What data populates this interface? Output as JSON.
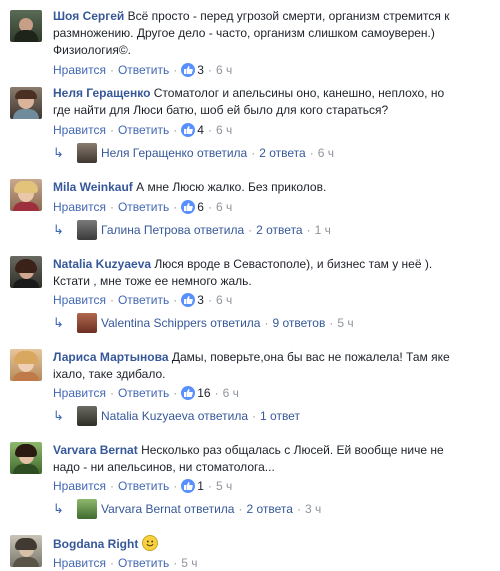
{
  "labels": {
    "like": "Нравится",
    "reply": "Ответить"
  },
  "comments": [
    {
      "name": "Шоя Сергей",
      "text": "Всё просто - перед угрозой смерти, организм стремится к размножению. Другое дело - часто, организм слишком самоуверен.) Физиология©.",
      "likes": "3",
      "time": "6 ч"
    },
    {
      "name": "Неля Геращенко",
      "text": "Стоматолог и апельсины оно, канешно, неплохо, но где найти для Люси батю, шоб ей было для кого стараться?",
      "likes": "4",
      "time": "6 ч",
      "reply": {
        "name": "Неля Геращенко",
        "verb": "ответила",
        "count": "2 ответа",
        "time": "6 ч"
      }
    },
    {
      "name": "Mila Weinkauf",
      "text": "А мне Люсю жалко. Без приколов.",
      "likes": "6",
      "time": "6 ч",
      "reply": {
        "name": "Галина Петрова",
        "verb": "ответила",
        "count": "2 ответа",
        "time": "1 ч"
      }
    },
    {
      "name": "Natalia Kuzyaeva",
      "text": "Люся вроде в Севастополе), и бизнес там у неё ). Кстати , мне тоже ее немного жаль.",
      "likes": "3",
      "time": "6 ч",
      "reply": {
        "name": "Valentina Schippers",
        "verb": "ответила",
        "count": "9 ответов",
        "time": "5 ч"
      }
    },
    {
      "name": "Лариса Мартынова",
      "text": "Дамы, поверьте,она бы вас не пожалела! Там яке іхало, таке здибало.",
      "likes": "16",
      "time": "6 ч",
      "reply": {
        "name": "Natalia Kuzyaeva",
        "verb": "ответила",
        "count": "1 ответ",
        "time": ""
      }
    },
    {
      "name": "Varvara Bernat",
      "text": "Несколько раз общалась с Люсей. Ей вообще ниче не надо - ни апельсинов, ни стоматолога...",
      "likes": "1",
      "time": "5 ч",
      "reply": {
        "name": "Varvara Bernat",
        "verb": "ответила",
        "count": "2 ответа",
        "time": "3 ч"
      }
    },
    {
      "name": "Bogdana Right",
      "text": "",
      "likes": "",
      "time": "5 ч"
    }
  ]
}
